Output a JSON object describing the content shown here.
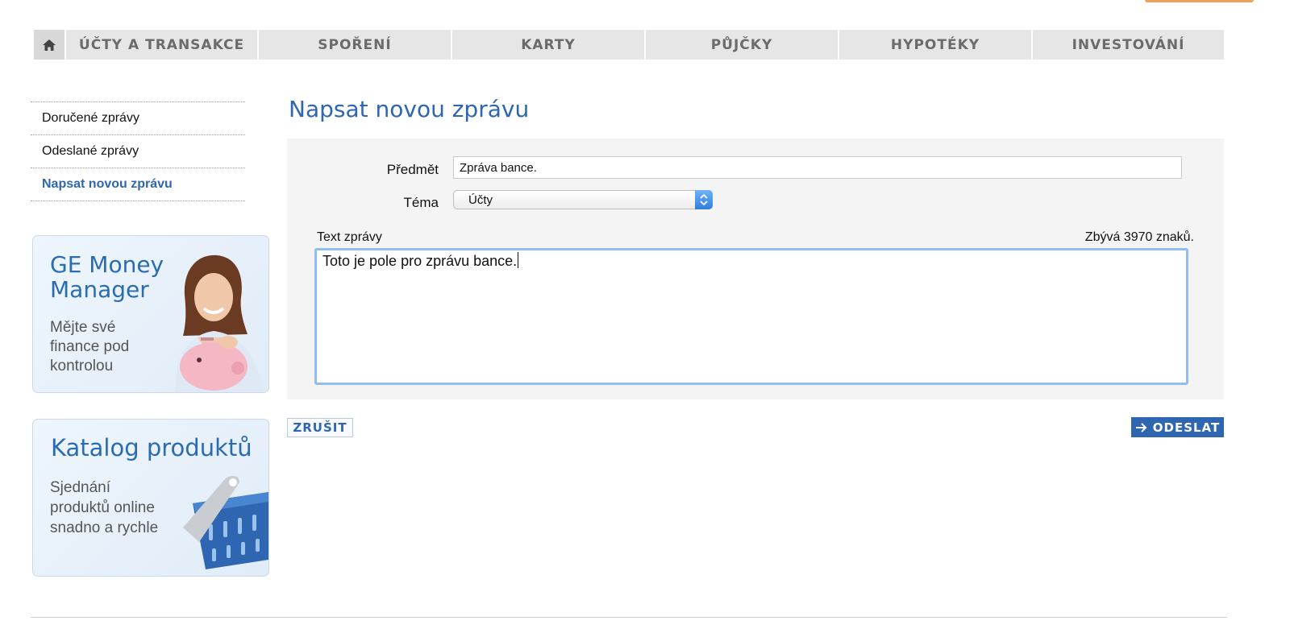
{
  "nav": {
    "home_icon": "home-icon",
    "items": [
      "ÚČTY A TRANSAKCE",
      "SPOŘENÍ",
      "KARTY",
      "PŮJČKY",
      "HYPOTÉKY",
      "INVESTOVÁNÍ"
    ]
  },
  "sidebar": {
    "items": [
      {
        "label": "Doručené zprávy"
      },
      {
        "label": "Odeslané zprávy"
      },
      {
        "label": "Napsat novou zprávu"
      }
    ],
    "promos": [
      {
        "title_line1": "GE Money",
        "title_line2": "Manager",
        "text_line1": "Mějte své",
        "text_line2": "finance pod",
        "text_line3": "kontrolou"
      },
      {
        "title": "Katalog produktů",
        "text_line1": "Sjednání",
        "text_line2": "produktů online",
        "text_line3": "snadno a rychle"
      }
    ]
  },
  "main": {
    "title": "Napsat novou zprávu",
    "subject_label": "Předmět",
    "subject_value": "Zpráva bance.",
    "topic_label": "Téma",
    "topic_value": "Účty",
    "message_label": "Text zprávy",
    "remaining": "Zbývá 3970 znaků.",
    "message_value": "Toto je pole pro zprávu bance.",
    "cancel_label": "ZRUŠIT",
    "send_label": "ODESLAT"
  },
  "colors": {
    "accent": "#2e66b2",
    "nav_bg": "#e6e6e6",
    "panel_bg": "#f4f4f4",
    "focus": "#8fbcf2"
  }
}
